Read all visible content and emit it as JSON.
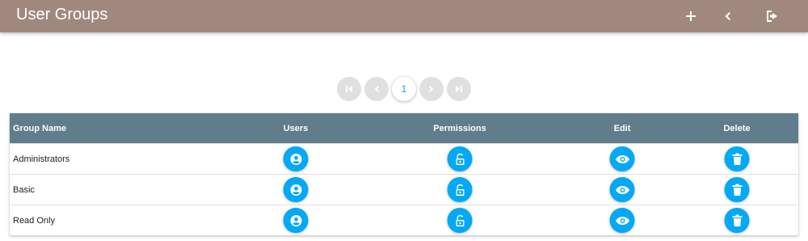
{
  "header": {
    "title": "User Groups",
    "actions": [
      "add-icon",
      "chevron-left-icon",
      "logout-icon"
    ]
  },
  "pagination": {
    "current_page": "1",
    "controls": [
      "first-page-icon",
      "chevron-left-icon",
      "chevron-right-icon",
      "last-page-icon"
    ]
  },
  "table": {
    "columns": [
      "Group Name",
      "Users",
      "Permissions",
      "Edit",
      "Delete"
    ],
    "rows": [
      {
        "name": "Administrators"
      },
      {
        "name": "Basic"
      },
      {
        "name": "Read Only"
      }
    ],
    "row_action_icons": [
      "account-circle-icon",
      "lock-open-icon",
      "eye-icon",
      "trash-icon"
    ]
  },
  "colors": {
    "header_bg": "#a1887f",
    "table_header_bg": "#607d8b",
    "action_button": "#03a9f4",
    "pager_disabled": "#e0e0e0"
  }
}
